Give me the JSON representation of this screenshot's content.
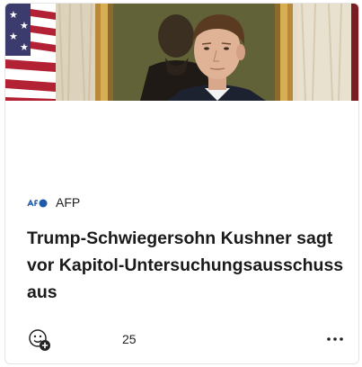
{
  "card": {
    "image_alt": "Jared Kushner im Oval Office",
    "source": {
      "logo_icon": "afp-logo-icon",
      "name": "AFP"
    },
    "headline": "Trump-Schwiegersohn Kushner sagt vor Kapitol-Untersuchungsausschuss aus",
    "footer": {
      "reaction_icon": "add-reaction-icon",
      "reaction_count": "25",
      "more_icon": "more-options-icon"
    }
  },
  "colors": {
    "flag_red": "#b22234",
    "flag_blue": "#3c3b6e",
    "afp_blue": "#1e5aa8",
    "curtain": "#e6ddc9",
    "frame_gold": "#c89a3e"
  }
}
